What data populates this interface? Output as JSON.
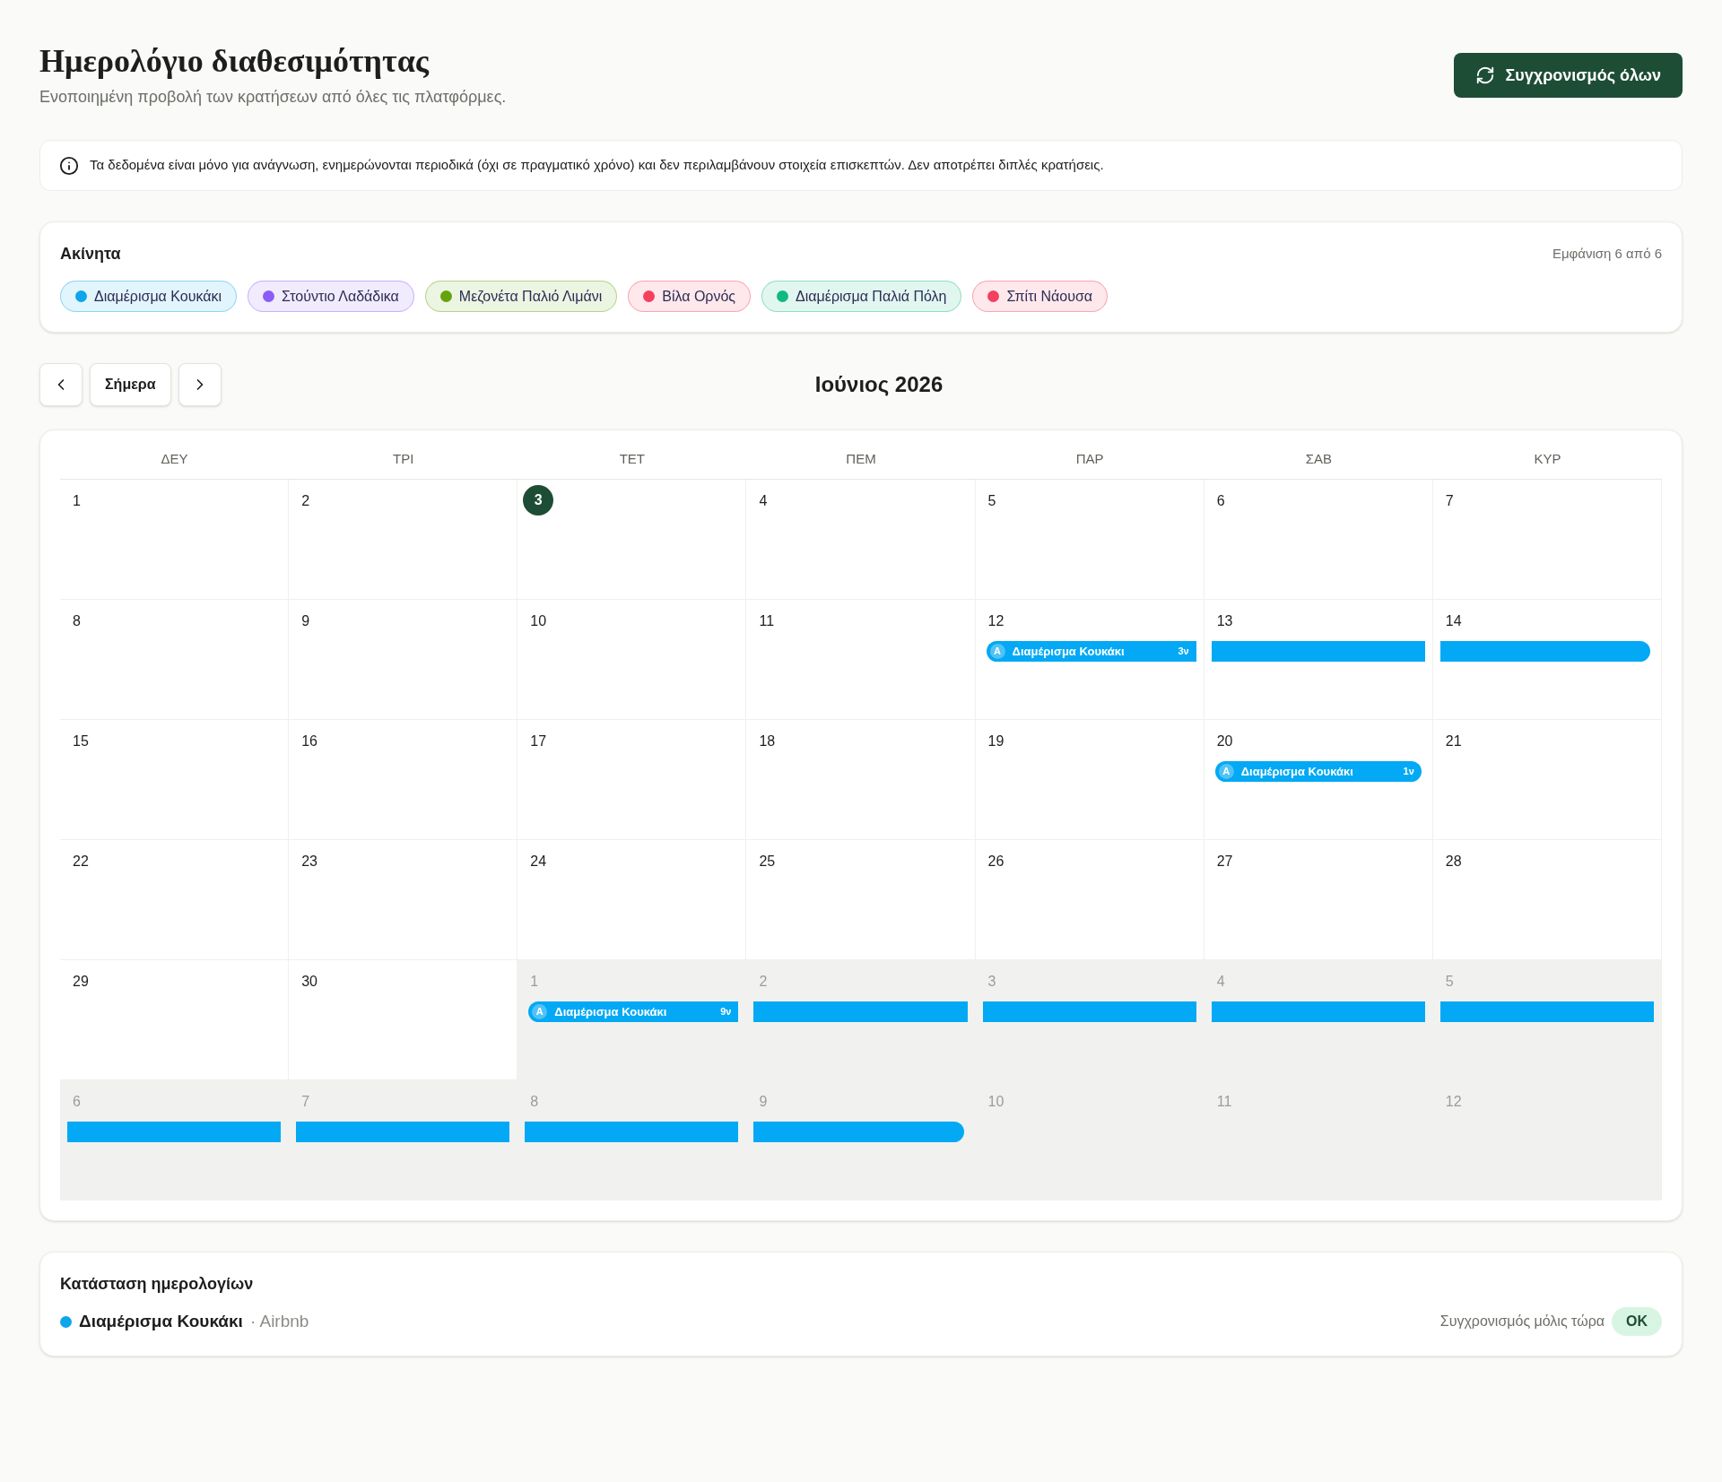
{
  "header": {
    "title": "Ημερολόγιο διαθεσιμότητας",
    "subtitle": "Ενοποιημένη προβολή των κρατήσεων από όλες τις πλατφόρμες.",
    "sync_button": "Συγχρονισμός όλων"
  },
  "notice": "Τα δεδομένα είναι μόνο για ανάγνωση, ενημερώνονται περιοδικά (όχι σε πραγματικό χρόνο) και δεν περιλαμβάνουν στοιχεία επισκεπτών. Δεν αποτρέπει διπλές κρατήσεις.",
  "properties": {
    "title": "Ακίνητα",
    "count": "Εμφάνιση 6 από 6",
    "items": [
      {
        "label": "Διαμέρισμα Κουκάκι",
        "color": "#0ea5e9"
      },
      {
        "label": "Στούντιο Λαδάδικα",
        "color": "#8b5cf6"
      },
      {
        "label": "Μεζονέτα Παλιό Λιμάνι",
        "color": "#65a30d"
      },
      {
        "label": "Βίλα Ορνός",
        "color": "#f43f5e"
      },
      {
        "label": "Διαμέρισμα Παλιά Πόλη",
        "color": "#10b981"
      },
      {
        "label": "Σπίτι Νάουσα",
        "color": "#f43f5e"
      }
    ]
  },
  "nav": {
    "today": "Σήμερα",
    "month": "Ιούνιος 2026"
  },
  "calendar": {
    "weekdays": [
      "ΔΕΥ",
      "ΤΡΙ",
      "ΤΕΤ",
      "ΠΕΜ",
      "ΠΑΡ",
      "ΣΑΒ",
      "ΚΥΡ"
    ],
    "weeks": [
      [
        {
          "day": "1",
          "outside": false,
          "today": false
        },
        {
          "day": "2",
          "outside": false,
          "today": false
        },
        {
          "day": "3",
          "outside": false,
          "today": true
        },
        {
          "day": "4",
          "outside": false,
          "today": false
        },
        {
          "day": "5",
          "outside": false,
          "today": false
        },
        {
          "day": "6",
          "outside": false,
          "today": false
        },
        {
          "day": "7",
          "outside": false,
          "today": false
        }
      ],
      [
        {
          "day": "8",
          "outside": false,
          "today": false
        },
        {
          "day": "9",
          "outside": false,
          "today": false
        },
        {
          "day": "10",
          "outside": false,
          "today": false
        },
        {
          "day": "11",
          "outside": false,
          "today": false
        },
        {
          "day": "12",
          "outside": false,
          "today": false,
          "bar": {
            "kind": "start",
            "color": "#03a9f4",
            "badge": "A",
            "label": "Διαμέρισμα Κουκάκι",
            "nights": "3ν"
          }
        },
        {
          "day": "13",
          "outside": false,
          "today": false,
          "bar": {
            "kind": "middle",
            "color": "#03a9f4"
          }
        },
        {
          "day": "14",
          "outside": false,
          "today": false,
          "bar": {
            "kind": "end",
            "color": "#03a9f4"
          }
        }
      ],
      [
        {
          "day": "15",
          "outside": false,
          "today": false
        },
        {
          "day": "16",
          "outside": false,
          "today": false
        },
        {
          "day": "17",
          "outside": false,
          "today": false
        },
        {
          "day": "18",
          "outside": false,
          "today": false
        },
        {
          "day": "19",
          "outside": false,
          "today": false
        },
        {
          "day": "20",
          "outside": false,
          "today": false,
          "bar": {
            "kind": "single",
            "color": "#03a9f4",
            "badge": "A",
            "label": "Διαμέρισμα Κουκάκι",
            "nights": "1ν"
          }
        },
        {
          "day": "21",
          "outside": false,
          "today": false
        }
      ],
      [
        {
          "day": "22",
          "outside": false,
          "today": false
        },
        {
          "day": "23",
          "outside": false,
          "today": false
        },
        {
          "day": "24",
          "outside": false,
          "today": false
        },
        {
          "day": "25",
          "outside": false,
          "today": false
        },
        {
          "day": "26",
          "outside": false,
          "today": false
        },
        {
          "day": "27",
          "outside": false,
          "today": false
        },
        {
          "day": "28",
          "outside": false,
          "today": false
        }
      ],
      [
        {
          "day": "29",
          "outside": false,
          "today": false
        },
        {
          "day": "30",
          "outside": false,
          "today": false
        },
        {
          "day": "1",
          "outside": true,
          "today": false,
          "bar": {
            "kind": "start",
            "color": "#03a9f4",
            "badge": "A",
            "label": "Διαμέρισμα Κουκάκι",
            "nights": "9ν"
          }
        },
        {
          "day": "2",
          "outside": true,
          "today": false,
          "bar": {
            "kind": "middle",
            "color": "#03a9f4"
          }
        },
        {
          "day": "3",
          "outside": true,
          "today": false,
          "bar": {
            "kind": "middle",
            "color": "#03a9f4"
          }
        },
        {
          "day": "4",
          "outside": true,
          "today": false,
          "bar": {
            "kind": "middle",
            "color": "#03a9f4"
          }
        },
        {
          "day": "5",
          "outside": true,
          "today": false,
          "bar": {
            "kind": "middle",
            "color": "#03a9f4"
          }
        }
      ],
      [
        {
          "day": "6",
          "outside": true,
          "today": false,
          "bar": {
            "kind": "middle",
            "color": "#03a9f4"
          }
        },
        {
          "day": "7",
          "outside": true,
          "today": false,
          "bar": {
            "kind": "middle",
            "color": "#03a9f4"
          }
        },
        {
          "day": "8",
          "outside": true,
          "today": false,
          "bar": {
            "kind": "middle",
            "color": "#03a9f4"
          }
        },
        {
          "day": "9",
          "outside": true,
          "today": false,
          "bar": {
            "kind": "end",
            "color": "#03a9f4"
          }
        },
        {
          "day": "10",
          "outside": true,
          "today": false
        },
        {
          "day": "11",
          "outside": true,
          "today": false
        },
        {
          "day": "12",
          "outside": true,
          "today": false
        }
      ]
    ]
  },
  "status": {
    "title": "Κατάσταση ημερολογίων",
    "rows": [
      {
        "name": "Διαμέρισμα Κουκάκι",
        "color": "#0ea5e9",
        "source": "· Airbnb",
        "sync": "Συγχρονισμός μόλις τώρα",
        "badge": "OK"
      }
    ]
  }
}
